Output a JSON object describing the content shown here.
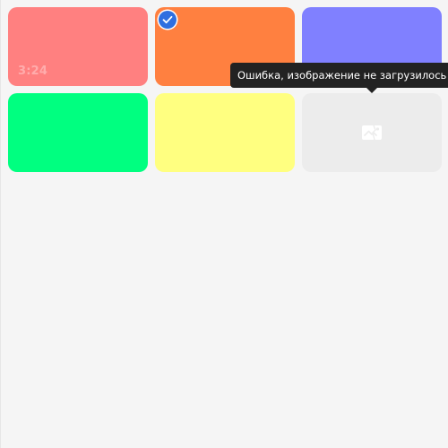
{
  "gallery": {
    "tiles": [
      {
        "name": "tile-1",
        "color": "#ff8080",
        "duration": "3:24",
        "selected": false,
        "broken": false
      },
      {
        "name": "tile-2",
        "color": "#ff8040",
        "duration": "",
        "selected": true,
        "broken": false
      },
      {
        "name": "tile-3",
        "color": "#8080ff",
        "duration": "",
        "selected": false,
        "broken": false
      },
      {
        "name": "tile-4",
        "color": "#00ff80",
        "duration": "",
        "selected": false,
        "broken": false
      },
      {
        "name": "tile-5",
        "color": "#ffff80",
        "duration": "",
        "selected": false,
        "broken": false
      },
      {
        "name": "tile-6",
        "color": "#ececec",
        "duration": "",
        "selected": false,
        "broken": true,
        "icon": "broken-image-icon"
      }
    ]
  },
  "tooltip": {
    "text": "Ошибка, изображение не загрузилось",
    "background": "#222222",
    "color": "#ffffff"
  },
  "colors": {
    "page_background": "#f5f5f5",
    "selection_accent": "#2f6fe0"
  }
}
